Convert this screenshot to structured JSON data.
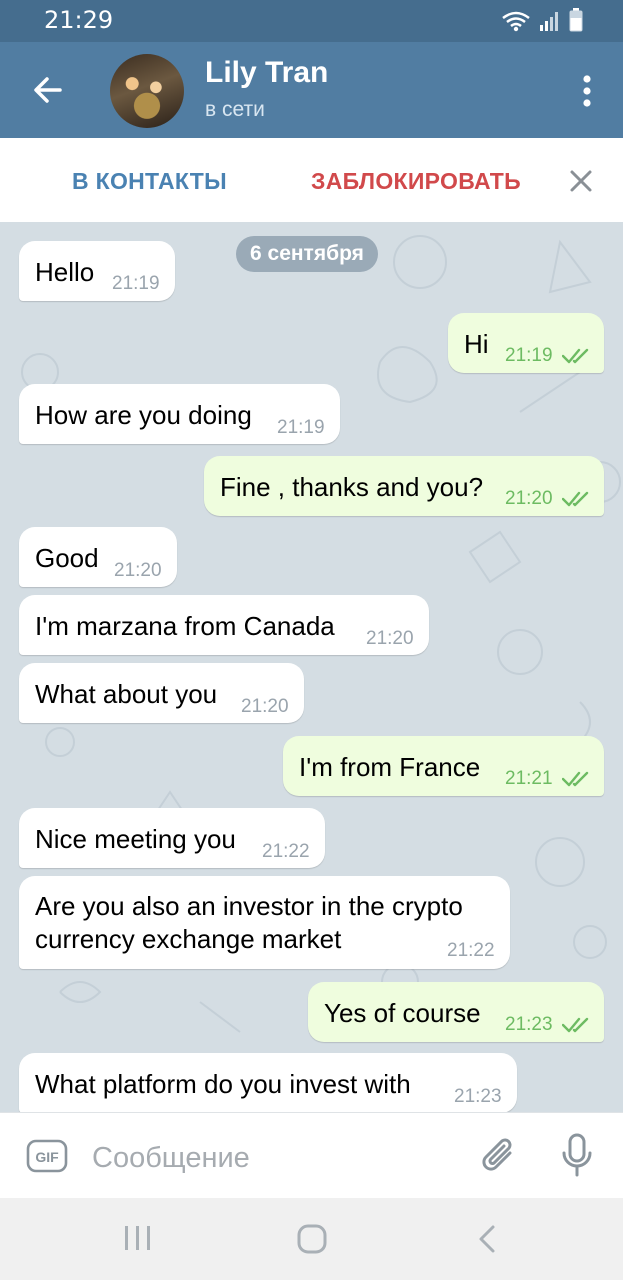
{
  "status_bar": {
    "time": "21:29"
  },
  "header": {
    "contact_name": "Lily Tran",
    "contact_status": "в сети"
  },
  "actions": {
    "add_contact": "В КОНТАКТЫ",
    "block": "ЗАБЛОКИРОВАТЬ"
  },
  "chat": {
    "date": "6 сентября",
    "messages": [
      {
        "dir": "in",
        "text": "Hello",
        "time": "21:19"
      },
      {
        "dir": "out",
        "text": "Hi",
        "time": "21:19",
        "read": true
      },
      {
        "dir": "in",
        "text": "How are you doing",
        "time": "21:19"
      },
      {
        "dir": "out",
        "text": "Fine , thanks and you?",
        "time": "21:20",
        "read": true
      },
      {
        "dir": "in",
        "text": "Good",
        "time": "21:20"
      },
      {
        "dir": "in",
        "text": "I'm marzana from Canada",
        "time": "21:20"
      },
      {
        "dir": "in",
        "text": "What about you",
        "time": "21:20"
      },
      {
        "dir": "out",
        "text": "I'm from France",
        "time": "21:21",
        "read": true
      },
      {
        "dir": "in",
        "text": "Nice meeting you",
        "time": "21:22"
      },
      {
        "dir": "in",
        "text": "Are you also an investor in the crypto currency exchange market",
        "time": "21:22"
      },
      {
        "dir": "out",
        "text": "Yes of course",
        "time": "21:23",
        "read": true
      },
      {
        "dir": "in",
        "text": "What platform do you invest with",
        "time": "21:23"
      }
    ]
  },
  "composer": {
    "gif_label": "GIF",
    "placeholder": "Сообщение",
    "value": ""
  },
  "icons": {
    "back": "arrow-left-icon",
    "more": "more-vertical-icon",
    "close": "close-icon",
    "attach": "paperclip-icon",
    "mic": "microphone-icon",
    "read_receipt": "double-check-icon"
  },
  "colors": {
    "app_bar": "#517da2",
    "status_bar": "#456d8e",
    "incoming_bubble": "#ffffff",
    "outgoing_bubble": "#effdde",
    "read_ticks": "#6dbb62",
    "block_text": "#d1494b",
    "add_text": "#4a82b2"
  }
}
